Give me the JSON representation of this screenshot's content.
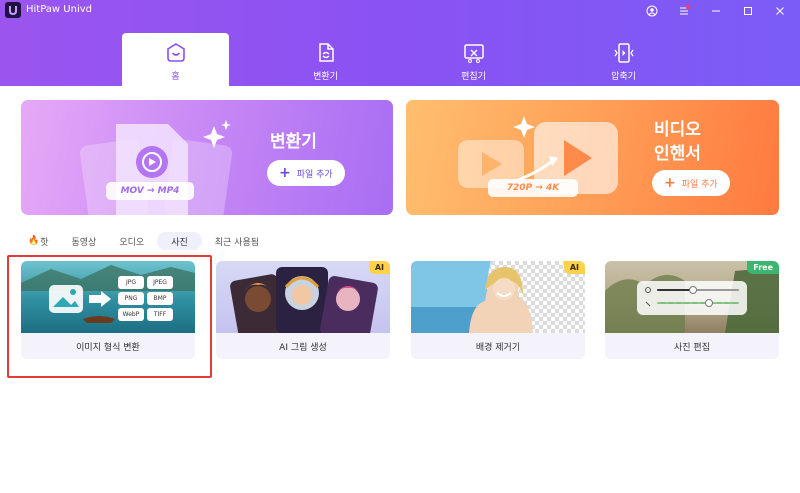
{
  "app": {
    "title": "HitPaw Univd"
  },
  "nav_tabs": [
    {
      "label": "홈",
      "icon": "home-icon",
      "active": true
    },
    {
      "label": "변환기",
      "icon": "converter-icon",
      "active": false
    },
    {
      "label": "편집기",
      "icon": "editor-icon",
      "active": false
    },
    {
      "label": "압축기",
      "icon": "compressor-icon",
      "active": false
    }
  ],
  "banners": {
    "converter": {
      "title": "변환기",
      "button": "파일 추가",
      "badge": "MOV → MP4"
    },
    "enhancer": {
      "title_line1": "비디오",
      "title_line2": "인핸서",
      "button": "파일 추가",
      "badge": "720P → 4K"
    }
  },
  "filters": [
    {
      "label": "핫",
      "active": false
    },
    {
      "label": "동영상",
      "active": false
    },
    {
      "label": "오디오",
      "active": false
    },
    {
      "label": "사진",
      "active": true
    },
    {
      "label": "최근 사용됨",
      "active": false
    }
  ],
  "cards": [
    {
      "label": "이미지 형식 변환",
      "badge": "",
      "formats": [
        "JPG",
        "JPEG",
        "PNG",
        "BMP",
        "WebP",
        "TIFF"
      ]
    },
    {
      "label": "AI 그림 생성",
      "badge": "AI"
    },
    {
      "label": "배경 제거기",
      "badge": "AI"
    },
    {
      "label": "사진 편집",
      "badge": "Free"
    }
  ],
  "colors": {
    "header": "#8a52f3",
    "accent": "#8a50f0",
    "highlight": "#e53a3a"
  }
}
